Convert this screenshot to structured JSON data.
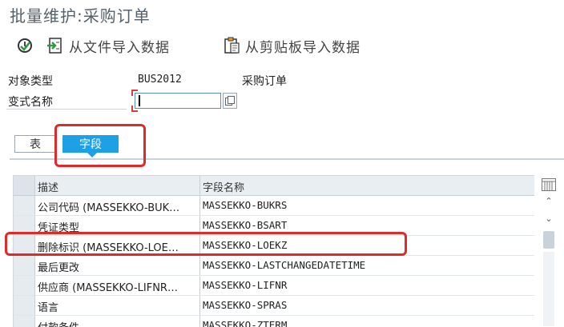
{
  "window": {
    "title": "批量维护:采购订单"
  },
  "toolbar": {
    "buttons": [
      {
        "icon": "execute-clock-icon",
        "label": ""
      },
      {
        "icon": "import-file-icon",
        "label": "从文件导入数据"
      },
      {
        "icon": "clipboard-icon",
        "label": "从剪贴板导入数据"
      }
    ]
  },
  "form": {
    "object_type_label": "对象类型",
    "object_type_code": "BUS2012",
    "object_type_name": "采购订单",
    "variant_label": "变式名称",
    "variant_value": ""
  },
  "tabs": [
    {
      "label": "表",
      "active": false
    },
    {
      "label": "字段",
      "active": true
    }
  ],
  "grid": {
    "headers": [
      "描述",
      "字段名称"
    ],
    "rows": [
      {
        "desc": "公司代码 (MASSEKKO-BUK…",
        "field": "MASSEKKO-BUKRS"
      },
      {
        "desc": "凭证类型",
        "field": "MASSEKKO-BSART"
      },
      {
        "desc": "删除标识 (MASSEKKO-LOE…",
        "field": "MASSEKKO-LOEKZ"
      },
      {
        "desc": "最后更改",
        "field": "MASSEKKO-LASTCHANGEDATETIME"
      },
      {
        "desc": "供应商 (MASSEKKO-LIFNR…",
        "field": "MASSEKKO-LIFNR"
      },
      {
        "desc": "语言",
        "field": "MASSEKKO-SPRAS"
      },
      {
        "desc": "付款条件",
        "field": "MASSEKKO-ZTERM"
      }
    ]
  },
  "colors": {
    "accent": "#1ea0e6",
    "highlight": "#e02a2a"
  }
}
